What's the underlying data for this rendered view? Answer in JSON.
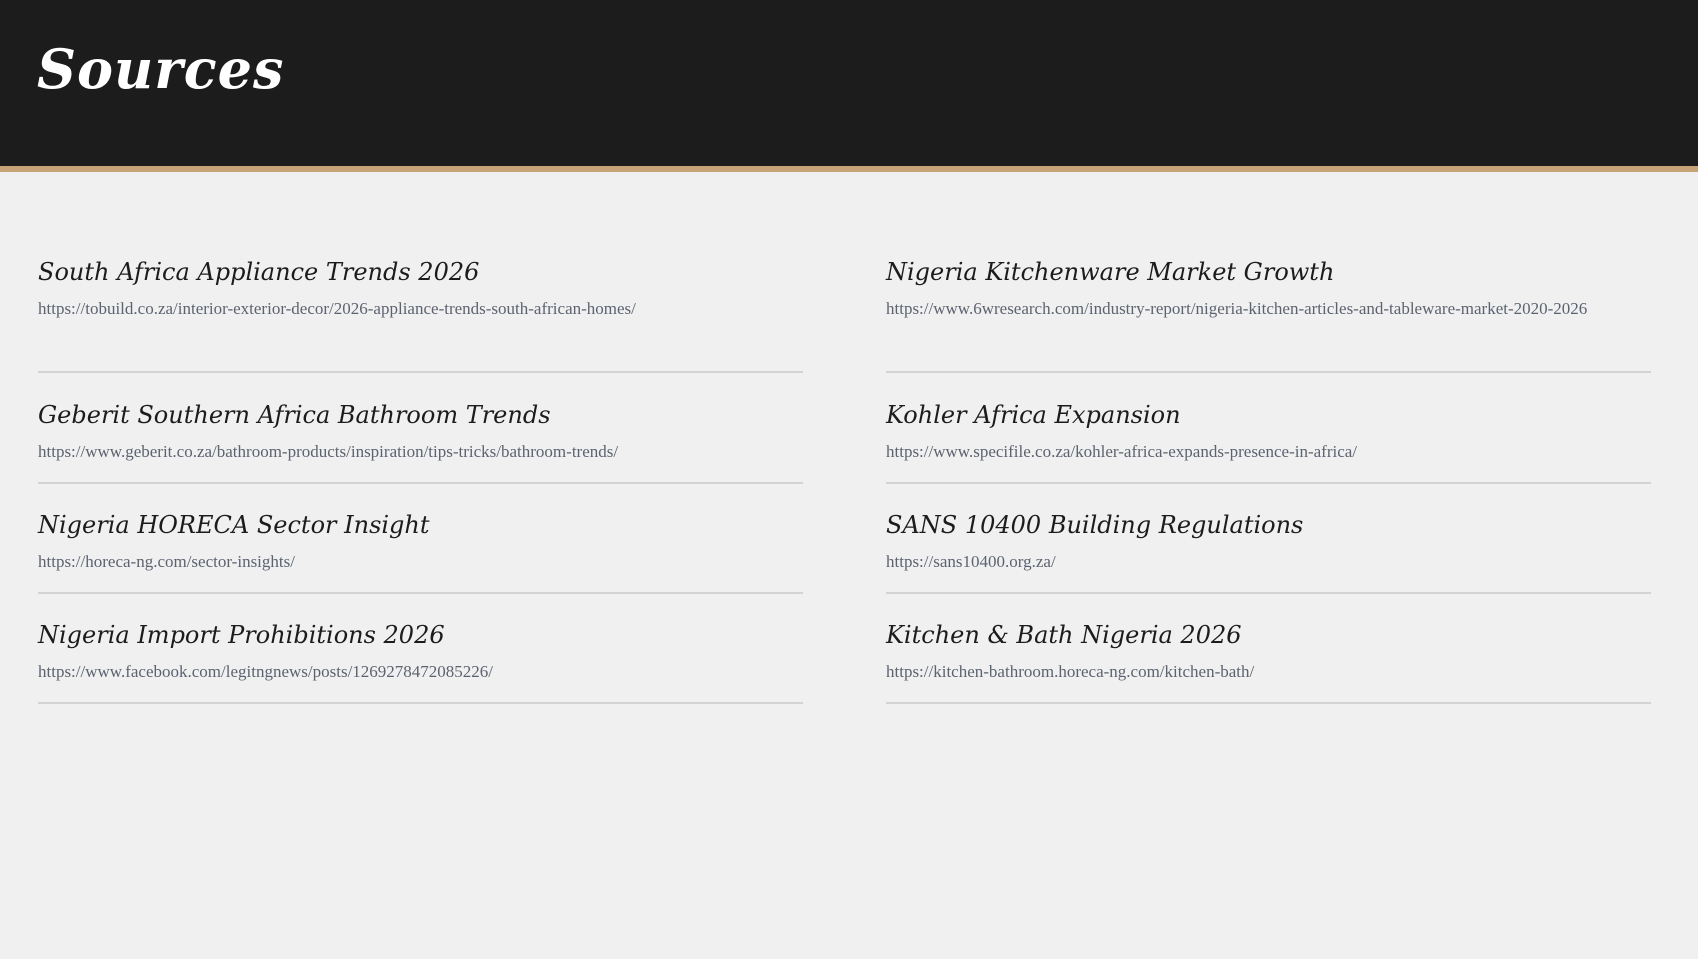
{
  "header": {
    "title": "Sources"
  },
  "colors": {
    "header_bg": "#1c1c1c",
    "accent": "#c6a478",
    "background": "#f0f0f0",
    "url_text": "#5c6370"
  },
  "sources": {
    "left": [
      {
        "title": "South Africa Appliance Trends 2026",
        "url": "https://tobuild.co.za/interior-exterior-decor/2026-appliance-trends-south-african-homes/"
      },
      {
        "title": "Geberit Southern Africa Bathroom Trends",
        "url": "https://www.geberit.co.za/bathroom-products/inspiration/tips-tricks/bathroom-trends/"
      },
      {
        "title": "Nigeria HORECA Sector Insight",
        "url": "https://horeca-ng.com/sector-insights/"
      },
      {
        "title": "Nigeria Import Prohibitions 2026",
        "url": "https://www.facebook.com/legitngnews/posts/1269278472085226/"
      }
    ],
    "right": [
      {
        "title": "Nigeria Kitchenware Market Growth",
        "url": "https://www.6wresearch.com/industry-report/nigeria-kitchen-articles-and-tableware-market-2020-2026"
      },
      {
        "title": "Kohler Africa Expansion",
        "url": "https://www.specifile.co.za/kohler-africa-expands-presence-in-africa/"
      },
      {
        "title": "SANS 10400 Building Regulations",
        "url": "https://sans10400.org.za/"
      },
      {
        "title": "Kitchen & Bath Nigeria 2026",
        "url": "https://kitchen-bathroom.horeca-ng.com/kitchen-bath/"
      }
    ]
  }
}
